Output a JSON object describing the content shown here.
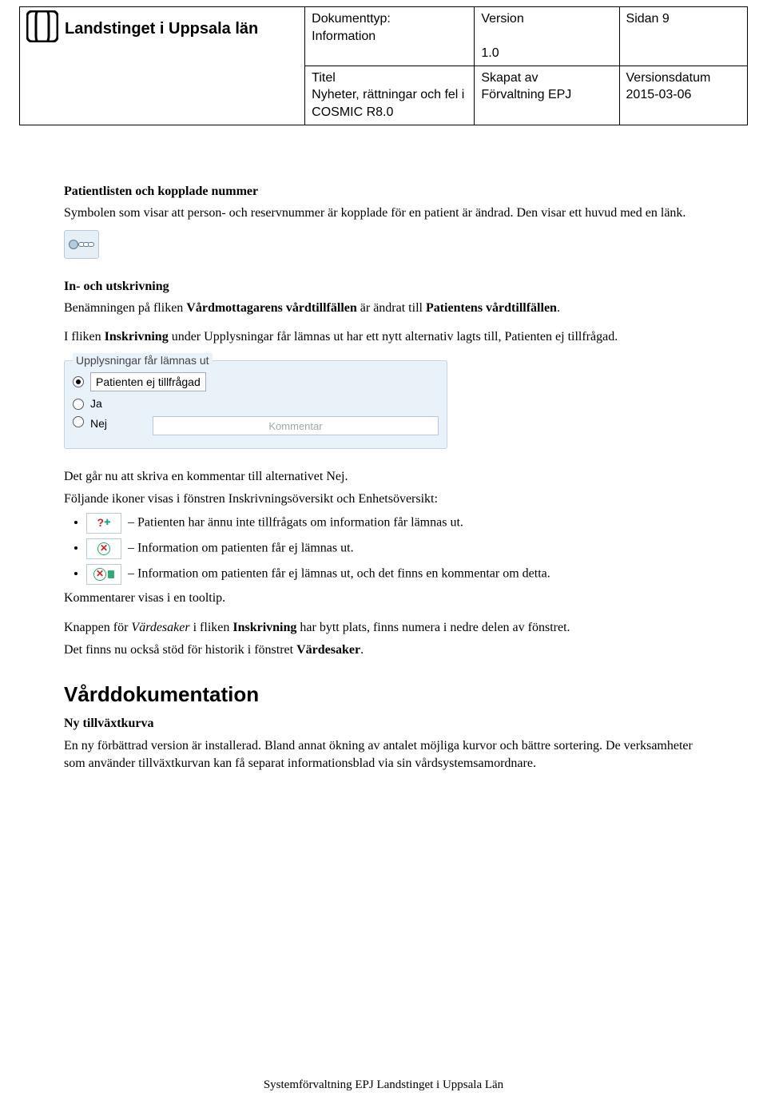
{
  "header": {
    "org_name": "Landstinget i Uppsala län",
    "doc_type_label": "Dokumenttyp:",
    "doc_type_value": "Information",
    "title_label": "Titel",
    "title_value": "Nyheter, rättningar och fel i COSMIC R8.0",
    "version_label": "Version",
    "version_value": "1.0",
    "created_by_label": "Skapat av",
    "created_by_value": "Förvaltning EPJ",
    "page_label": "Sidan 9",
    "version_date_label": "Versionsdatum",
    "version_date_value": "2015-03-06"
  },
  "s1": {
    "title": "Patientlisten och kopplade nummer",
    "p1": "Symbolen som visar att person- och reservnummer är kopplade för en patient är ändrad. Den visar ett huvud med en länk."
  },
  "s2": {
    "title": "In- och utskrivning",
    "p1a": "Benämningen på fliken ",
    "p1b": "Vårdmottagarens vårdtillfällen",
    "p1c": " är ändrat till ",
    "p1d": "Patientens vårdtillfällen",
    "p1e": ".",
    "p2a": "I fliken ",
    "p2b": "Inskrivning",
    "p2c": " under Upplysningar får lämnas ut har ett nytt alternativ lagts till, Patienten ej tillfrågad."
  },
  "panel": {
    "legend": "Upplysningar får lämnas ut",
    "opt1": "Patienten ej tillfrågad",
    "opt2": "Ja",
    "opt3": "Nej",
    "comment_placeholder": "Kommentar"
  },
  "s3": {
    "p1": "Det går nu att skriva en kommentar till alternativet Nej.",
    "p2": "Följande ikoner visas i fönstren Inskrivningsöversikt och Enhetsöversikt:",
    "li1": " – Patienten har ännu inte tillfrågats om information får lämnas ut.",
    "li2": " – Information om patienten får ej lämnas ut.",
    "li3": " – Information om patienten får ej lämnas ut, och det finns en kommentar om detta.",
    "p3": "Kommentarer visas i en tooltip.",
    "p4a": "Knappen för ",
    "p4b": "Värdesaker",
    "p4c": " i fliken ",
    "p4d": "Inskrivning",
    "p4e": " har bytt plats, finns numera i nedre delen av fönstret.",
    "p5a": "Det finns nu också stöd för historik i fönstret ",
    "p5b": "Värdesaker",
    "p5c": "."
  },
  "s4": {
    "heading": "Vårddokumentation",
    "sub": "Ny tillväxtkurva",
    "p1": "En ny förbättrad version är installerad. Bland annat ökning av antalet möjliga kurvor och bättre sortering. De verksamheter som använder tillväxtkurvan kan få separat informationsblad via sin vårdsystemsamordnare."
  },
  "footer": "Systemförvaltning EPJ Landstinget i Uppsala Län"
}
